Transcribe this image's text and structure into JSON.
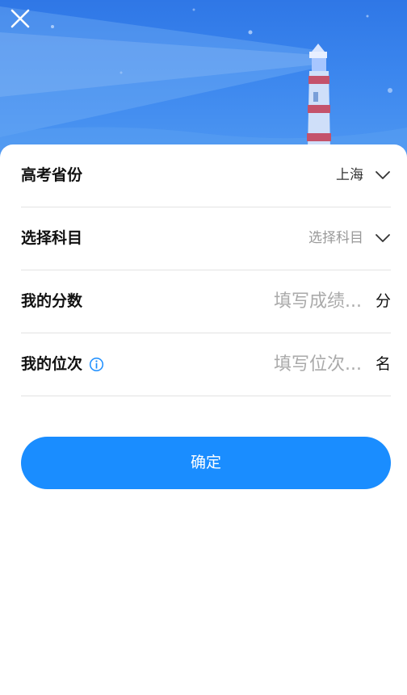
{
  "header": {
    "close_icon": "close-icon"
  },
  "form": {
    "province": {
      "label": "高考省份",
      "value": "上海",
      "icon": "chevron-down-icon"
    },
    "subject": {
      "label": "选择科目",
      "placeholder": "选择科目",
      "icon": "chevron-down-icon"
    },
    "score": {
      "label": "我的分数",
      "placeholder": "填写成绩...",
      "unit": "分"
    },
    "rank": {
      "label": "我的位次",
      "placeholder": "填写位次...",
      "unit": "名",
      "info_icon": "info-icon"
    }
  },
  "actions": {
    "confirm_label": "确定"
  },
  "colors": {
    "primary": "#1a8dff",
    "hero_top": "#2f77e6",
    "hero_bottom": "#4f98f2"
  }
}
